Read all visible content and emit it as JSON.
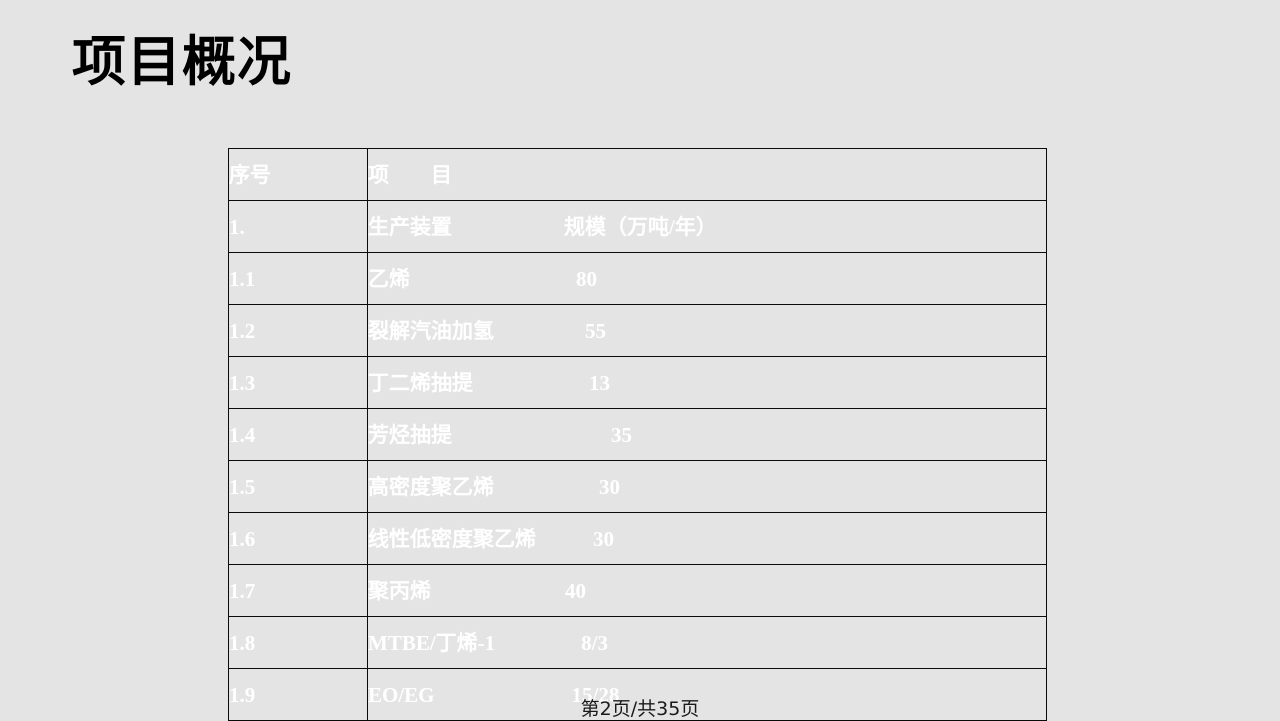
{
  "slide": {
    "title": "项目概况",
    "background_color": "#e4e4e4",
    "footer": "第2页/共35页"
  },
  "table": {
    "columns": [
      "序号",
      "项　　目"
    ],
    "header": {
      "no": "序号",
      "item": "项　　目",
      "value": ""
    },
    "text_color": "#ffffff",
    "border_color": "#0a0a0a",
    "cell_background": "#e4e4e4",
    "highlight_background": "#ffff66",
    "highlight_text_color": "#ec1c80",
    "rows": [
      {
        "no": "1.",
        "item": "生产装置",
        "value": "规模（万吨/年）",
        "highlight": false
      },
      {
        "no": "1.1",
        "item": "乙烯",
        "value": "80",
        "highlight": true
      },
      {
        "no": "1.2",
        "item": "裂解汽油加氢",
        "value": "55",
        "highlight": false
      },
      {
        "no": "1.3",
        "item": "丁二烯抽提",
        "value": "13",
        "highlight": false
      },
      {
        "no": "1.4",
        "item": "芳烃抽提",
        "value": "35",
        "highlight": false
      },
      {
        "no": "1.5",
        "item": "高密度聚乙烯",
        "value": "30",
        "highlight": false
      },
      {
        "no": "1.6",
        "item": "线性低密度聚乙烯",
        "value": "30",
        "highlight": false
      },
      {
        "no": "1.7",
        "item": "聚丙烯",
        "value": "40",
        "highlight": false
      },
      {
        "no": "1.8",
        "item": "MTBE/丁烯-1",
        "value": "8/3",
        "highlight": false
      },
      {
        "no": "1.9",
        "item": "EO/EG",
        "value": "15/28",
        "highlight": false
      }
    ]
  }
}
